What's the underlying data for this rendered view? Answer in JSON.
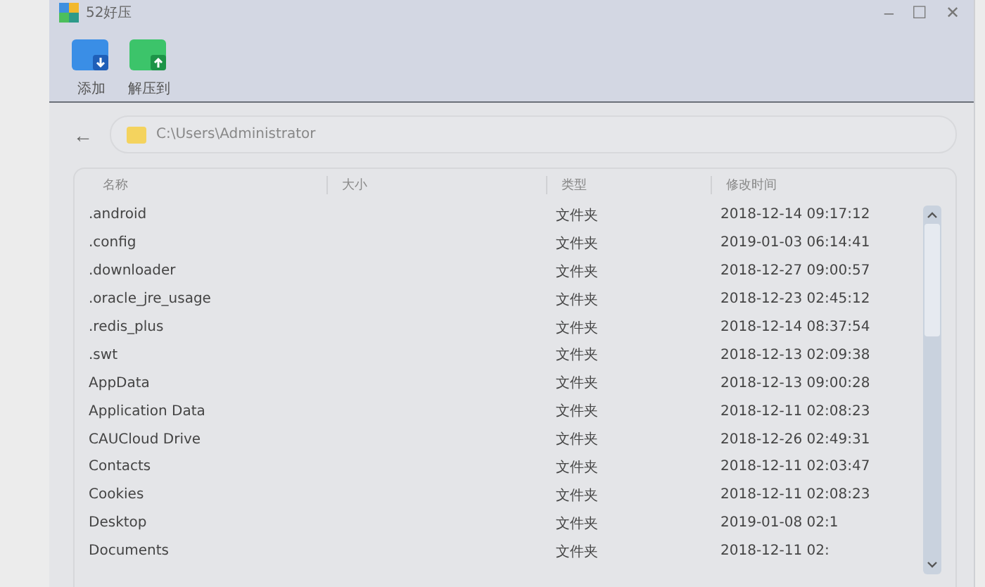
{
  "window": {
    "title": "52好压",
    "controls": [
      "–",
      "☐",
      "✕"
    ]
  },
  "toolbar": [
    {
      "label": "添加",
      "kind": "add"
    },
    {
      "label": "解压到",
      "kind": "extract"
    }
  ],
  "address_bar": {
    "back": "←",
    "path": "C:\\Users\\Administrator"
  },
  "table": {
    "columns": [
      "名称",
      "大小",
      "类型",
      "修改时间"
    ],
    "rows": [
      {
        "name": ".android",
        "type": "文件夹",
        "modified": "2018-12-14 09:17:12"
      },
      {
        "name": ".config",
        "type": "文件夹",
        "modified": "2019-01-03 06:14:41"
      },
      {
        "name": ".downloader",
        "type": "文件夹",
        "modified": "2018-12-27 09:00:57"
      },
      {
        "name": ".oracle_jre_usage",
        "type": "文件夹",
        "modified": "2018-12-23 02:45:12"
      },
      {
        "name": ".redis_plus",
        "type": "文件夹",
        "modified": "2018-12-14 08:37:54"
      },
      {
        "name": ".swt",
        "type": "文件夹",
        "modified": "2018-12-13 02:09:38"
      },
      {
        "name": "AppData",
        "type": "文件夹",
        "modified": "2018-12-13 09:00:28"
      },
      {
        "name": "Application Data",
        "type": "文件夹",
        "modified": "2018-12-11 02:08:23"
      },
      {
        "name": "CAUCloud Drive",
        "type": "文件夹",
        "modified": "2018-12-26 02:49:31"
      },
      {
        "name": "Contacts",
        "type": "文件夹",
        "modified": "2018-12-11 02:03:47"
      },
      {
        "name": "Cookies",
        "type": "文件夹",
        "modified": "2018-12-11 02:08:23"
      },
      {
        "name": "Desktop",
        "type": "文件夹",
        "modified": "2019-01-08 02:1"
      },
      {
        "name": "Documents",
        "type": "文件夹",
        "modified": "2018-12-11 02:"
      }
    ]
  }
}
